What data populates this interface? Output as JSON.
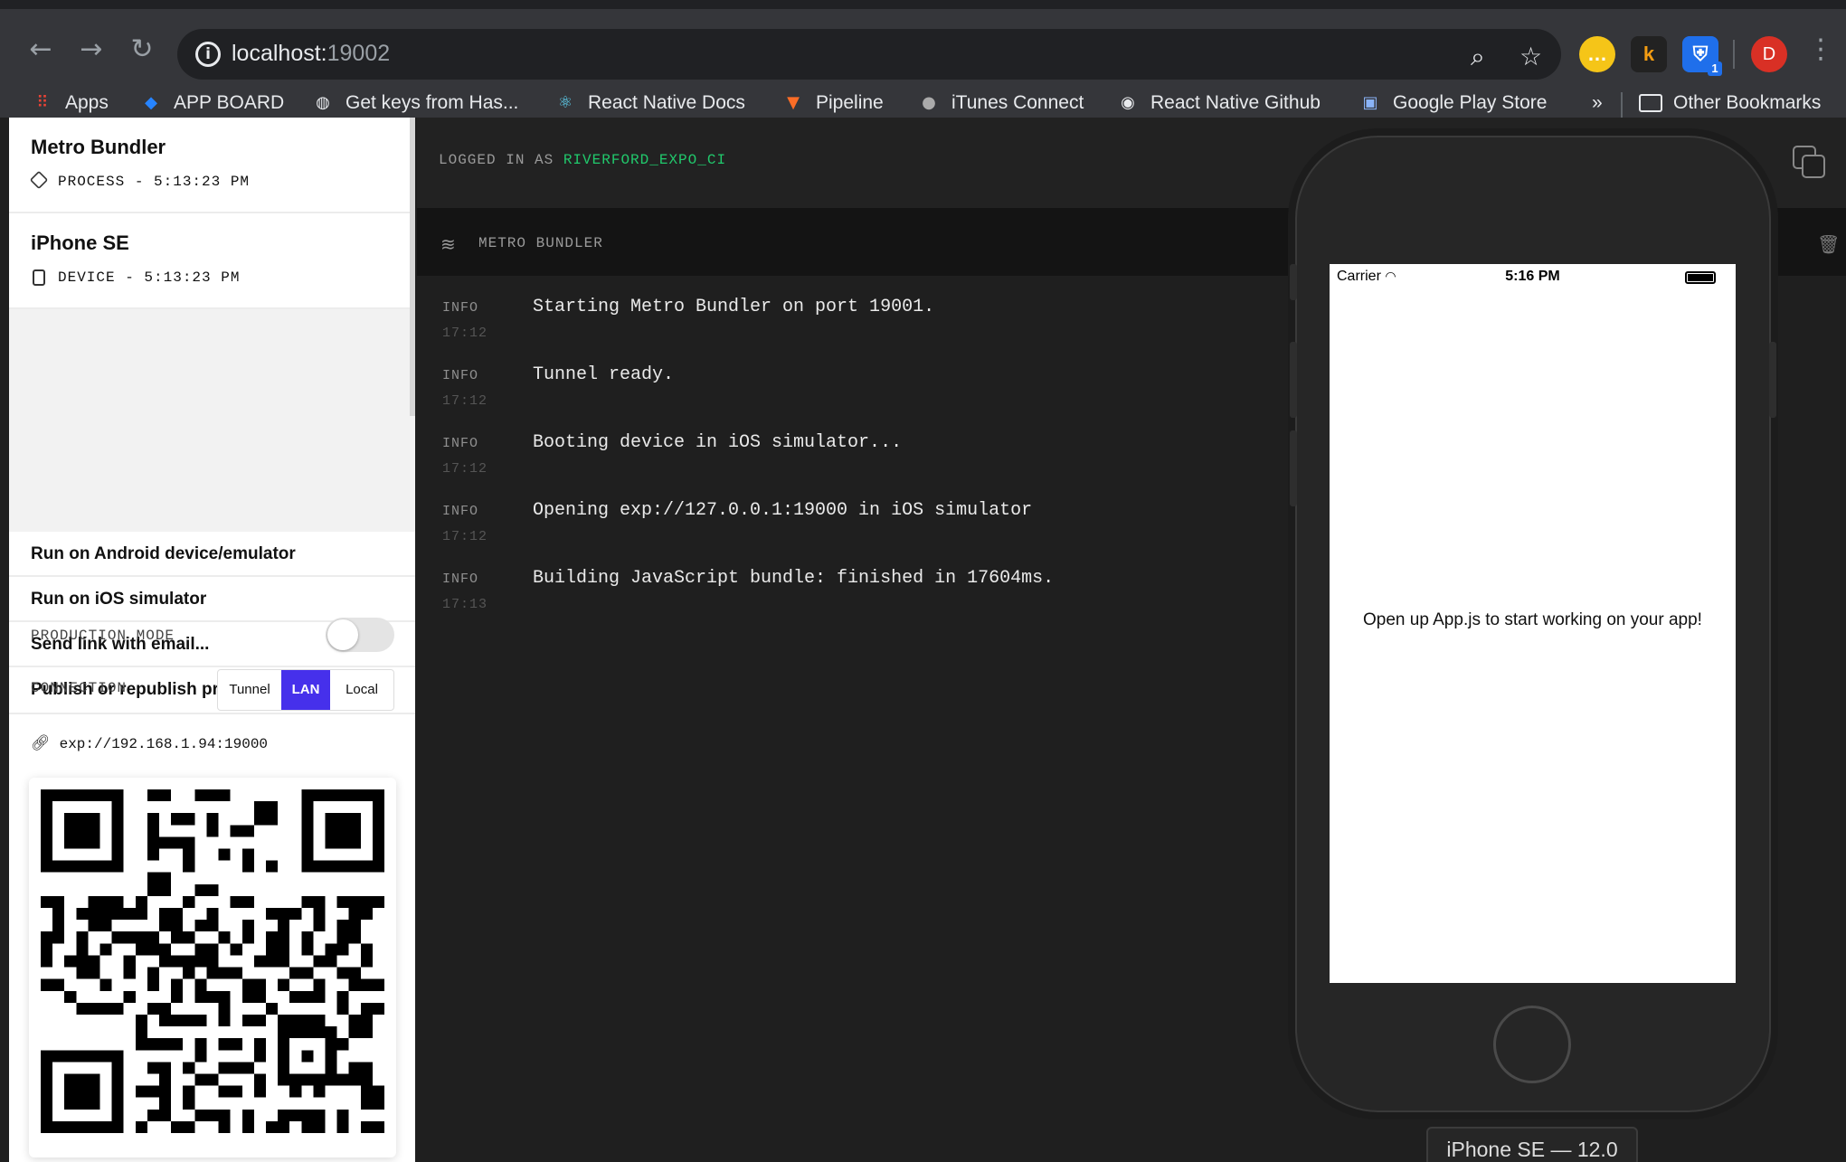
{
  "browser": {
    "url_host": "localhost:",
    "url_port": "19002",
    "profile_initial": "D",
    "bookmarks": [
      {
        "label": "Apps",
        "icon": "apps-grid-icon"
      },
      {
        "label": "APP BOARD",
        "icon": "jira-diamond-icon"
      },
      {
        "label": "Get keys from Has...",
        "icon": "globe-icon"
      },
      {
        "label": "React Native Docs",
        "icon": "react-atom-icon"
      },
      {
        "label": "Pipeline",
        "icon": "gitlab-fox-icon"
      },
      {
        "label": "iTunes Connect",
        "icon": "apple-icon"
      },
      {
        "label": "React Native Github",
        "icon": "github-icon"
      },
      {
        "label": "Google Play Store",
        "icon": "image-icon"
      }
    ],
    "more": "»",
    "other_bookmarks": "Other Bookmarks",
    "badge": "1"
  },
  "sidebar": {
    "process_title": "Metro Bundler",
    "process_sub": "PROCESS - 5:13:23 PM",
    "device_title": "iPhone SE",
    "device_sub": "DEVICE - 5:13:23 PM",
    "actions": [
      "Run on Android device/emulator",
      "Run on iOS simulator",
      "Send link with email...",
      "Publish or republish project..."
    ],
    "production_label": "PRODUCTION MODE",
    "production_on": false,
    "connection_label": "CONNECTION",
    "connection_options": [
      "Tunnel",
      "LAN",
      "Local"
    ],
    "connection_selected": "LAN",
    "exp_url": "exp://192.168.1.94:19000"
  },
  "main": {
    "logged_in_prefix": "LOGGED IN AS ",
    "logged_in_user": "RIVERFORD_EXPO_CI",
    "log_title": "METRO BUNDLER",
    "logs": [
      {
        "level": "INFO",
        "time": "17:12",
        "message": "Starting Metro Bundler on port 19001."
      },
      {
        "level": "INFO",
        "time": "17:12",
        "message": "Tunnel ready."
      },
      {
        "level": "INFO",
        "time": "17:12",
        "message": "Booting device in iOS simulator..."
      },
      {
        "level": "INFO",
        "time": "17:12",
        "message": "Opening exp://127.0.0.1:19000 in iOS simulator"
      },
      {
        "level": "INFO",
        "time": "17:13",
        "message": "Building JavaScript bundle: finished in 17604ms."
      }
    ]
  },
  "simulator": {
    "carrier": "Carrier",
    "clock": "5:16 PM",
    "app_text": "Open up App.js to start working on your app!",
    "device_label": "iPhone SE — 12.0"
  }
}
